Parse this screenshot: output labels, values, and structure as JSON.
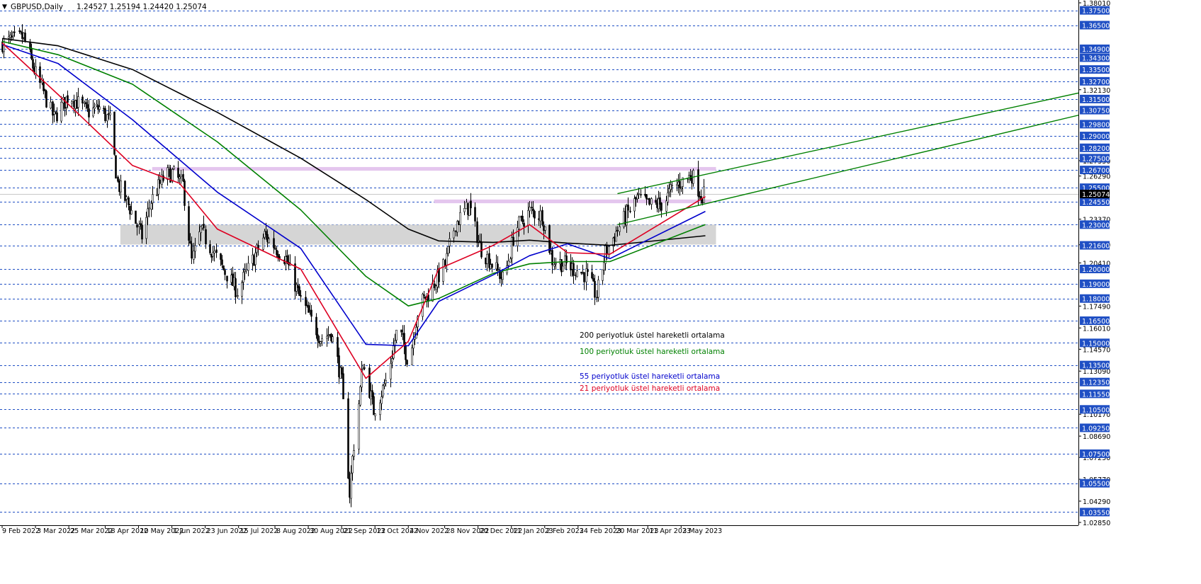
{
  "header": {
    "symbol": "GBPUSD,Daily",
    "ohlc": "1.24527 1.25194 1.24420 1.25074"
  },
  "colors": {
    "ema200": "#000000",
    "ema100": "#008000",
    "ema55": "#0000cc",
    "ema21": "#dd0022",
    "channel": "#008000",
    "zone": "#d0d0d0",
    "resistance_band": "#e4c6ee",
    "level_line": "#1f4fc4",
    "label_bg": "#1f4fc4",
    "current_bg": "#000000"
  },
  "chart_data": {
    "type": "candlestick",
    "title": "GBPUSD,Daily",
    "ylim": [
      1.0285,
      1.3801
    ],
    "grid": false,
    "x_tick_labels": [
      "9 Feb 2022",
      "3 Mar 2022",
      "25 Mar 2022",
      "18 Apr 2022",
      "10 May 2022",
      "1 Jun 2022",
      "23 Jun 2022",
      "15 Jul 2022",
      "8 Aug 2022",
      "30 Aug 2022",
      "21 Sep 2022",
      "13 Oct 2022",
      "4 Nov 2022",
      "28 Nov 2022",
      "20 Dec 2022",
      "11 Jan 2023",
      "2 Feb 2023",
      "24 Feb 2023",
      "20 Mar 2023",
      "11 Apr 2023",
      "3 May 2023"
    ],
    "y_tick_labels": [
      "1.38010",
      "1.32130",
      "1.27330",
      "1.26290",
      "1.23370",
      "1.21640",
      "1.20410",
      "1.17490",
      "1.16010",
      "1.14570",
      "1.13090",
      "1.10170",
      "1.08690",
      "1.07250",
      "1.05770",
      "1.04290",
      "1.02850"
    ],
    "level_labels": [
      "1.37500",
      "1.36500",
      "1.34900",
      "1.34300",
      "1.33500",
      "1.32700",
      "1.31500",
      "1.30750",
      "1.29800",
      "1.29000",
      "1.28200",
      "1.27500",
      "1.26700",
      "1.25500",
      "1.24550",
      "1.23000",
      "1.21600",
      "1.20000",
      "1.19000",
      "1.18000",
      "1.16500",
      "1.15000",
      "1.13500",
      "1.12350",
      "1.11550",
      "1.10500",
      "1.09250",
      "1.07500",
      "1.05500",
      "1.03550"
    ],
    "current_price": "1.25074",
    "legend": [
      {
        "name": "200 periyotluk üstel hareketli ortalama",
        "color": "#000000"
      },
      {
        "name": "100 periyotluk üstel hareketli ortalama",
        "color": "#008000"
      },
      {
        "name": "55 periyotluk üstel hareketli ortalama",
        "color": "#0000cc"
      },
      {
        "name": "21 periyotluk üstel hareketli ortalama",
        "color": "#dd0022"
      }
    ],
    "price_path": [
      [
        "2022-02-09",
        1.353
      ],
      [
        "2022-02-23",
        1.357
      ],
      [
        "2022-03-01",
        1.337
      ],
      [
        "2022-03-15",
        1.302
      ],
      [
        "2022-03-25",
        1.318
      ],
      [
        "2022-04-06",
        1.306
      ],
      [
        "2022-04-14",
        1.309
      ],
      [
        "2022-04-21",
        1.3
      ],
      [
        "2022-04-26",
        1.258
      ],
      [
        "2022-05-05",
        1.239
      ],
      [
        "2022-05-12",
        1.222
      ],
      [
        "2022-05-18",
        1.246
      ],
      [
        "2022-05-27",
        1.263
      ],
      [
        "2022-06-01",
        1.265
      ],
      [
        "2022-06-08",
        1.257
      ],
      [
        "2022-06-14",
        1.205
      ],
      [
        "2022-06-20",
        1.226
      ],
      [
        "2022-07-01",
        1.206
      ],
      [
        "2022-07-14",
        1.185
      ],
      [
        "2022-07-28",
        1.214
      ],
      [
        "2022-08-01",
        1.223
      ],
      [
        "2022-08-15",
        1.207
      ],
      [
        "2022-08-24",
        1.181
      ],
      [
        "2022-09-07",
        1.153
      ],
      [
        "2022-09-14",
        1.157
      ],
      [
        "2022-09-21",
        1.123
      ],
      [
        "2022-09-26",
        1.048
      ],
      [
        "2022-09-28",
        1.072
      ],
      [
        "2022-10-05",
        1.137
      ],
      [
        "2022-10-12",
        1.104
      ],
      [
        "2022-10-20",
        1.124
      ],
      [
        "2022-10-28",
        1.161
      ],
      [
        "2022-11-04",
        1.137
      ],
      [
        "2022-11-11",
        1.176
      ],
      [
        "2022-11-17",
        1.183
      ],
      [
        "2022-11-28",
        1.203
      ],
      [
        "2022-12-05",
        1.231
      ],
      [
        "2022-12-14",
        1.243
      ],
      [
        "2022-12-21",
        1.215
      ],
      [
        "2023-01-06",
        1.192
      ],
      [
        "2023-01-13",
        1.226
      ],
      [
        "2023-01-23",
        1.239
      ],
      [
        "2023-01-31",
        1.236
      ],
      [
        "2023-02-07",
        1.206
      ],
      [
        "2023-02-16",
        1.203
      ],
      [
        "2023-03-01",
        1.196
      ],
      [
        "2023-03-08",
        1.182
      ],
      [
        "2023-03-14",
        1.211
      ],
      [
        "2023-03-22",
        1.227
      ],
      [
        "2023-04-04",
        1.248
      ],
      [
        "2023-04-12",
        1.243
      ],
      [
        "2023-04-21",
        1.244
      ],
      [
        "2023-04-28",
        1.256
      ],
      [
        "2023-05-05",
        1.26
      ],
      [
        "2023-05-10",
        1.264
      ],
      [
        "2023-05-16",
        1.25
      ],
      [
        "2023-05-19",
        1.2507
      ]
    ],
    "ema200": [
      [
        "2022-02-09",
        1.356
      ],
      [
        "2022-03-18",
        1.351
      ],
      [
        "2022-05-06",
        1.335
      ],
      [
        "2022-07-01",
        1.306
      ],
      [
        "2022-08-25",
        1.275
      ],
      [
        "2022-10-07",
        1.247
      ],
      [
        "2022-11-04",
        1.227
      ],
      [
        "2022-11-24",
        1.219
      ],
      [
        "2022-12-30",
        1.218
      ],
      [
        "2023-01-23",
        1.2195
      ],
      [
        "2023-02-17",
        1.2175
      ],
      [
        "2023-03-17",
        1.216
      ],
      [
        "2023-05-19",
        1.2225
      ]
    ],
    "ema100": [
      [
        "2022-02-09",
        1.354
      ],
      [
        "2022-03-18",
        1.345
      ],
      [
        "2022-05-06",
        1.325
      ],
      [
        "2022-07-01",
        1.286
      ],
      [
        "2022-08-25",
        1.24
      ],
      [
        "2022-10-07",
        1.195
      ],
      [
        "2022-11-04",
        1.175
      ],
      [
        "2022-11-24",
        1.18
      ],
      [
        "2022-12-30",
        1.197
      ],
      [
        "2023-01-23",
        1.2035
      ],
      [
        "2023-02-17",
        1.205
      ],
      [
        "2023-03-17",
        1.205
      ],
      [
        "2023-05-19",
        1.23
      ]
    ],
    "ema55": [
      [
        "2022-02-09",
        1.352
      ],
      [
        "2022-03-18",
        1.339
      ],
      [
        "2022-05-06",
        1.301
      ],
      [
        "2022-07-01",
        1.252
      ],
      [
        "2022-08-25",
        1.214
      ],
      [
        "2022-10-07",
        1.149
      ],
      [
        "2022-11-04",
        1.148
      ],
      [
        "2022-11-24",
        1.178
      ],
      [
        "2022-12-30",
        1.196
      ],
      [
        "2023-01-23",
        1.209
      ],
      [
        "2023-02-17",
        1.217
      ],
      [
        "2023-03-17",
        1.207
      ],
      [
        "2023-05-19",
        1.239
      ]
    ],
    "ema21": [
      [
        "2022-02-09",
        1.353
      ],
      [
        "2022-03-18",
        1.318
      ],
      [
        "2022-05-06",
        1.27
      ],
      [
        "2022-06-06",
        1.258
      ],
      [
        "2022-07-01",
        1.227
      ],
      [
        "2022-08-25",
        1.2
      ],
      [
        "2022-10-07",
        1.126
      ],
      [
        "2022-11-04",
        1.151
      ],
      [
        "2022-11-24",
        1.2
      ],
      [
        "2022-12-30",
        1.216
      ],
      [
        "2023-01-23",
        1.23
      ],
      [
        "2023-02-17",
        1.211
      ],
      [
        "2023-03-17",
        1.21
      ],
      [
        "2023-05-19",
        1.249
      ]
    ],
    "channel_upper": [
      [
        "2023-03-22",
        1.251
      ],
      [
        "2024-01-22",
        1.3195
      ]
    ],
    "channel_lower": [
      [
        "2023-03-22",
        1.23
      ],
      [
        "2024-01-22",
        1.3045
      ]
    ],
    "gray_zone": {
      "from": "2022-04-28",
      "to": "2023-05-26",
      "low": 1.2165,
      "high": 1.23
    },
    "resistance_band": {
      "from": "2022-05-19",
      "to": "2023-05-26",
      "low": 1.2665,
      "high": 1.269
    },
    "support_band": {
      "from": "2022-11-21",
      "to": "2023-05-23",
      "low": 1.2445,
      "high": 1.247
    }
  }
}
